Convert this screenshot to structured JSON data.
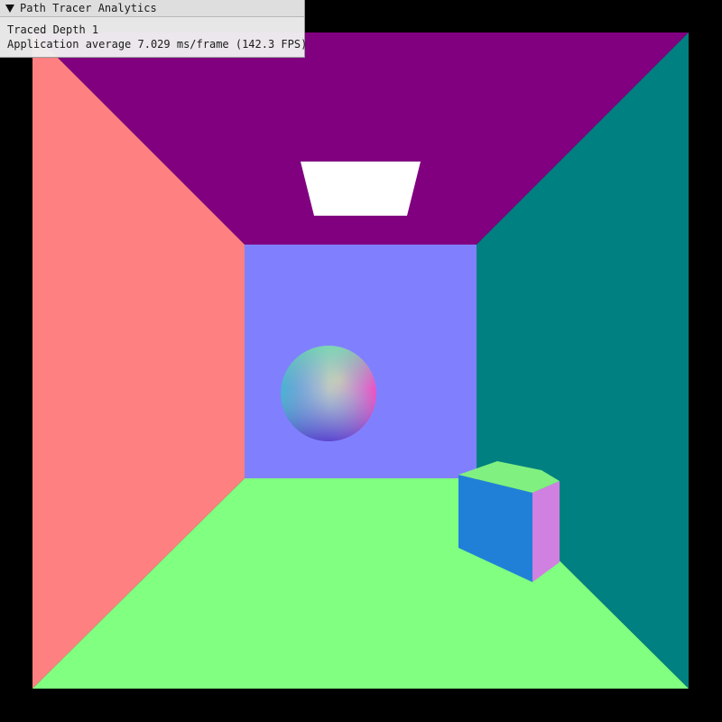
{
  "window": {
    "title": "Path Tracer Analytics",
    "collapse_icon": "triangle-down-icon"
  },
  "stats": {
    "traced_depth_text": "Traced Depth 1",
    "frame_timing_text": "Application average 7.029 ms/frame (142.3 FPS)"
  },
  "scene": {
    "background_color": "#000000",
    "ceiling_color": "#800080",
    "left_wall_color": "#ff8080",
    "right_wall_color": "#008080",
    "back_wall_color": "#8080ff",
    "floor_color": "#80ff80",
    "light_color": "#ffffff",
    "box_front_color": "#2080d8",
    "box_side_color": "#d080e0",
    "box_top_color": "#80f080"
  }
}
